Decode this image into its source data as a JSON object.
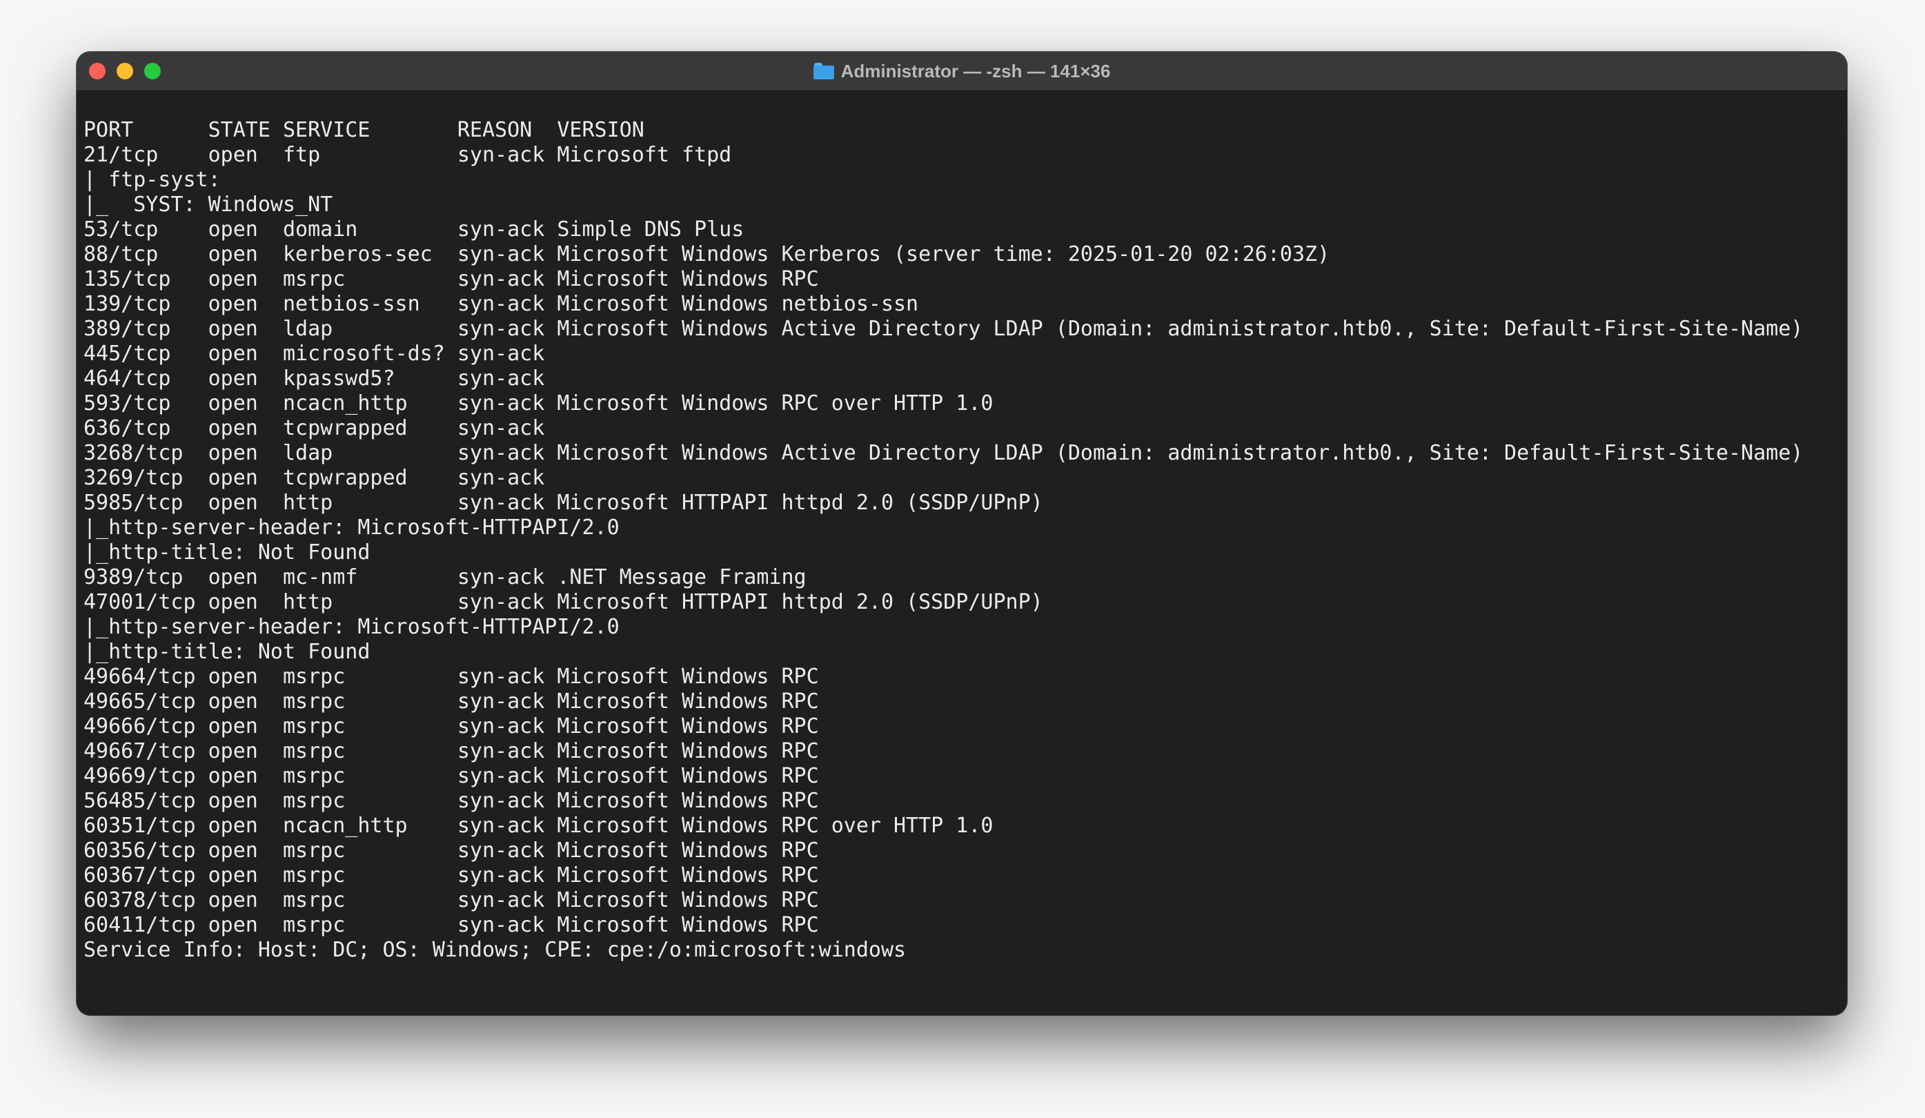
{
  "window": {
    "title": "Administrator — -zsh — 141×36"
  },
  "terminal": {
    "lines": [
      "PORT      STATE SERVICE       REASON  VERSION",
      "21/tcp    open  ftp           syn-ack Microsoft ftpd",
      "| ftp-syst:",
      "|_  SYST: Windows_NT",
      "53/tcp    open  domain        syn-ack Simple DNS Plus",
      "88/tcp    open  kerberos-sec  syn-ack Microsoft Windows Kerberos (server time: 2025-01-20 02:26:03Z)",
      "135/tcp   open  msrpc         syn-ack Microsoft Windows RPC",
      "139/tcp   open  netbios-ssn   syn-ack Microsoft Windows netbios-ssn",
      "389/tcp   open  ldap          syn-ack Microsoft Windows Active Directory LDAP (Domain: administrator.htb0., Site: Default-First-Site-Name)",
      "445/tcp   open  microsoft-ds? syn-ack",
      "464/tcp   open  kpasswd5?     syn-ack",
      "593/tcp   open  ncacn_http    syn-ack Microsoft Windows RPC over HTTP 1.0",
      "636/tcp   open  tcpwrapped    syn-ack",
      "3268/tcp  open  ldap          syn-ack Microsoft Windows Active Directory LDAP (Domain: administrator.htb0., Site: Default-First-Site-Name)",
      "3269/tcp  open  tcpwrapped    syn-ack",
      "5985/tcp  open  http          syn-ack Microsoft HTTPAPI httpd 2.0 (SSDP/UPnP)",
      "|_http-server-header: Microsoft-HTTPAPI/2.0",
      "|_http-title: Not Found",
      "9389/tcp  open  mc-nmf        syn-ack .NET Message Framing",
      "47001/tcp open  http          syn-ack Microsoft HTTPAPI httpd 2.0 (SSDP/UPnP)",
      "|_http-server-header: Microsoft-HTTPAPI/2.0",
      "|_http-title: Not Found",
      "49664/tcp open  msrpc         syn-ack Microsoft Windows RPC",
      "49665/tcp open  msrpc         syn-ack Microsoft Windows RPC",
      "49666/tcp open  msrpc         syn-ack Microsoft Windows RPC",
      "49667/tcp open  msrpc         syn-ack Microsoft Windows RPC",
      "49669/tcp open  msrpc         syn-ack Microsoft Windows RPC",
      "56485/tcp open  msrpc         syn-ack Microsoft Windows RPC",
      "60351/tcp open  ncacn_http    syn-ack Microsoft Windows RPC over HTTP 1.0",
      "60356/tcp open  msrpc         syn-ack Microsoft Windows RPC",
      "60367/tcp open  msrpc         syn-ack Microsoft Windows RPC",
      "60378/tcp open  msrpc         syn-ack Microsoft Windows RPC",
      "60411/tcp open  msrpc         syn-ack Microsoft Windows RPC",
      "Service Info: Host: DC; OS: Windows; CPE: cpe:/o:microsoft:windows"
    ]
  }
}
